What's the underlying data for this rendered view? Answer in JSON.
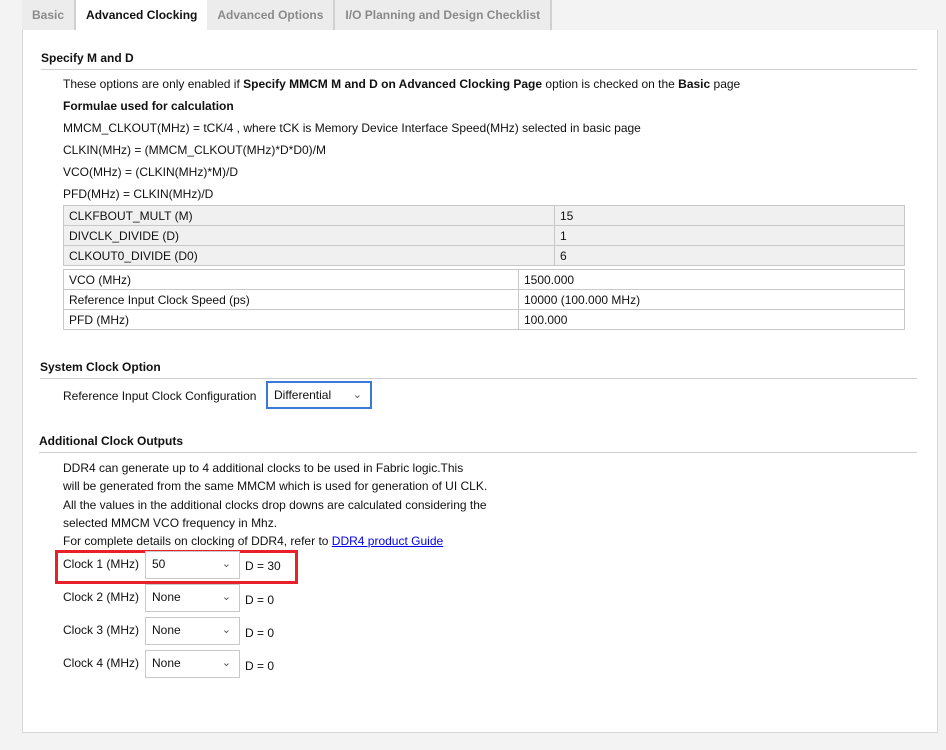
{
  "tabs": [
    "Basic",
    "Advanced Clocking",
    "Advanced Options",
    "I/O Planning and Design Checklist"
  ],
  "m_and_d": {
    "title": "Specify M and D",
    "note_prefix": "These options are only enabled if ",
    "note_bold1": "Specify MMCM M and D on Advanced Clocking Page",
    "note_mid": " option is checked on the ",
    "note_bold2": "Basic",
    "note_suffix": " page",
    "formula_title": "Formulae used for calculation",
    "formulas": [
      "MMCM_CLKOUT(MHz) = tCK/4 , where tCK is Memory Device Interface Speed(MHz) selected in basic page",
      "CLKIN(MHz) = (MMCM_CLKOUT(MHz)*D*D0)/M",
      "VCO(MHz) = (CLKIN(MHz)*M)/D",
      "PFD(MHz) = CLKIN(MHz)/D"
    ],
    "params": [
      {
        "name": "CLKFBOUT_MULT (M)",
        "value": "15"
      },
      {
        "name": "DIVCLK_DIVIDE (D)",
        "value": "1"
      },
      {
        "name": "CLKOUT0_DIVIDE (D0)",
        "value": "6"
      }
    ],
    "results": [
      {
        "name": "VCO (MHz)",
        "value": "1500.000"
      },
      {
        "name": "Reference Input Clock Speed (ps)",
        "value": "10000 (100.000 MHz)"
      },
      {
        "name": "PFD (MHz)",
        "value": "100.000"
      }
    ]
  },
  "system_clock": {
    "title": "System Clock Option",
    "label": "Reference Input Clock Configuration",
    "value": "Differential",
    "accent": "#3c78d8"
  },
  "additional": {
    "title": "Additional Clock Outputs",
    "lines": [
      "DDR4 can generate up to 4 additional clocks to be used in Fabric logic.This",
      "will be generated from the same MMCM which is used for generation of UI CLK.",
      "All the values in the additional clocks drop downs are calculated considering the",
      "selected MMCM VCO frequency in Mhz."
    ],
    "link_prefix": "For complete details on clocking of DDR4, refer to ",
    "link_text": "DDR4 product Guide",
    "highlight_color": "#e8202a",
    "clocks": [
      {
        "label": "Clock 1 (MHz)",
        "value": "50",
        "d": "D = 30"
      },
      {
        "label": "Clock 2 (MHz)",
        "value": "None",
        "d": "D = 0"
      },
      {
        "label": "Clock 3 (MHz)",
        "value": "None",
        "d": "D = 0"
      },
      {
        "label": "Clock 4 (MHz)",
        "value": "None",
        "d": "D = 0"
      }
    ]
  }
}
